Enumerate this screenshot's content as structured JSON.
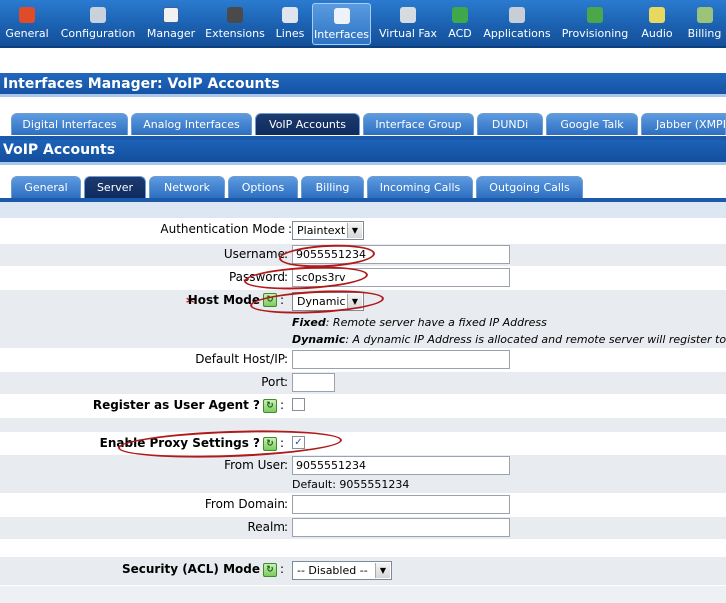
{
  "toolbar": {
    "items": [
      {
        "label": "General",
        "icon": "general-icon"
      },
      {
        "label": "Configuration",
        "icon": "configuration-icon"
      },
      {
        "label": "Manager",
        "icon": "manager-icon"
      },
      {
        "label": "Extensions",
        "icon": "extensions-icon"
      },
      {
        "label": "Lines",
        "icon": "lines-icon"
      },
      {
        "label": "Interfaces",
        "icon": "interfaces-icon",
        "active": true
      },
      {
        "label": "Virtual Fax",
        "icon": "fax-icon"
      },
      {
        "label": "ACD",
        "icon": "acd-icon"
      },
      {
        "label": "Applications",
        "icon": "applications-icon"
      },
      {
        "label": "Provisioning",
        "icon": "provisioning-icon"
      },
      {
        "label": "Audio",
        "icon": "audio-icon"
      },
      {
        "label": "Billing",
        "icon": "billing-icon"
      }
    ]
  },
  "page_title": "Interfaces Manager:  VoIP Accounts",
  "interface_tabs": [
    "Digital Interfaces",
    "Analog Interfaces",
    "VoIP Accounts",
    "Interface Group",
    "DUNDi",
    "Google Talk",
    "Jabber (XMPP)"
  ],
  "section_title": "VoIP Accounts",
  "account_tabs": [
    "General",
    "Server",
    "Network",
    "Options",
    "Billing",
    "Incoming Calls",
    "Outgoing Calls"
  ],
  "form": {
    "auth_mode_label": "Authentication Mode",
    "auth_mode_value": "Plaintext",
    "username_label": "Username",
    "username_value": "9055551234",
    "password_label": "Password",
    "password_value": "sc0ps3rv",
    "host_mode_label": "Host Mode",
    "host_mode_value": "Dynamic",
    "host_note_fixed_key": "Fixed",
    "host_note_fixed_text": ": Remote server have a fixed IP Address",
    "host_note_dynamic_key": "Dynamic",
    "host_note_dynamic_text": ": A dynamic IP Address is allocated and remote server will register to us.",
    "default_host_label": "Default Host/IP",
    "default_host_value": "",
    "port_label": "Port",
    "port_value": "",
    "register_label": "Register as User Agent ?",
    "register_checked": false,
    "proxy_label": "Enable Proxy Settings ?",
    "proxy_checked": true,
    "from_user_label": "From User",
    "from_user_value": "9055551234",
    "from_user_default": "Default: 9055551234",
    "from_domain_label": "From Domain",
    "from_domain_value": "",
    "realm_label": "Realm",
    "realm_value": "",
    "security_label": "Security (ACL) Mode",
    "security_value": "-- Disabled --"
  },
  "colon": ":",
  "required_star": "*",
  "help_glyph": "↻",
  "arrow_glyph": "▼",
  "check_glyph": "✓",
  "colors": {
    "toolbar": "#1a5fae",
    "header": "#1553a4",
    "active_tab": "#0d2b5e",
    "annotation": "#b01a1a",
    "row_shade": "#e8ebef"
  }
}
